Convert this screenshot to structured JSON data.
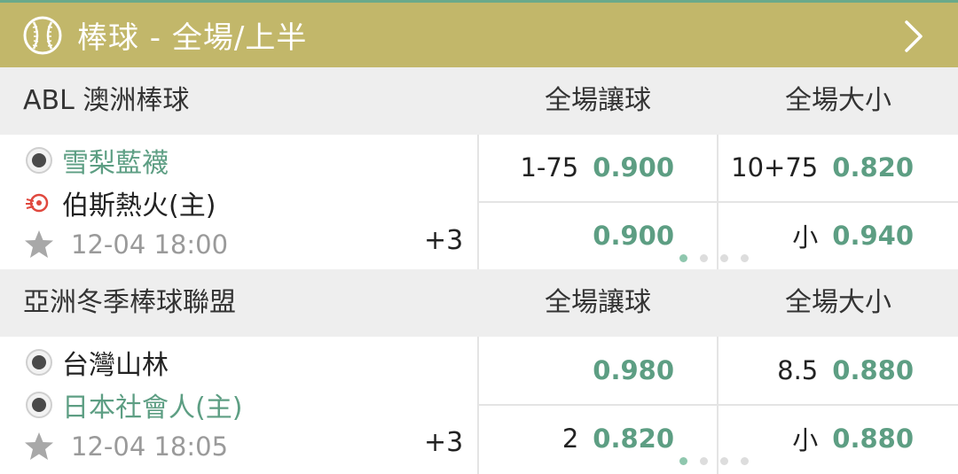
{
  "header": {
    "title": "棒球 - 全場/上半",
    "sport_icon": "baseball-icon",
    "nav_icon": "chevron-right-icon",
    "bg_color": "#c2b76a"
  },
  "leagues": [
    {
      "name": "ABL 澳洲棒球",
      "col1": "全場讓球",
      "col2": "全場大小",
      "match": {
        "home_team": "雪梨藍襪",
        "away_team": "伯斯熱火(主)",
        "datetime": "12-04 18:00",
        "more": "+3",
        "handicap": [
          {
            "label": "1-75",
            "odds": "0.900"
          },
          {
            "label": "",
            "odds": "0.900"
          }
        ],
        "overunder": [
          {
            "label": "10+75",
            "odds": "0.820"
          },
          {
            "label": "小",
            "odds": "0.940"
          }
        ]
      }
    },
    {
      "name": "亞洲冬季棒球聯盟",
      "col1": "全場讓球",
      "col2": "全場大小",
      "match": {
        "home_team": "台灣山林",
        "away_team": "日本社會人(主)",
        "datetime": "12-04 18:05",
        "more": "+3",
        "handicap": [
          {
            "label": "",
            "odds": "0.980"
          },
          {
            "label": "2",
            "odds": "0.820"
          }
        ],
        "overunder": [
          {
            "label": "8.5",
            "odds": "0.880"
          },
          {
            "label": "小",
            "odds": "0.880"
          }
        ]
      }
    }
  ],
  "colors": {
    "odds_green": "#5d9e83",
    "team_green": "#5d9e83",
    "time_gray": "#9a9a9a"
  }
}
